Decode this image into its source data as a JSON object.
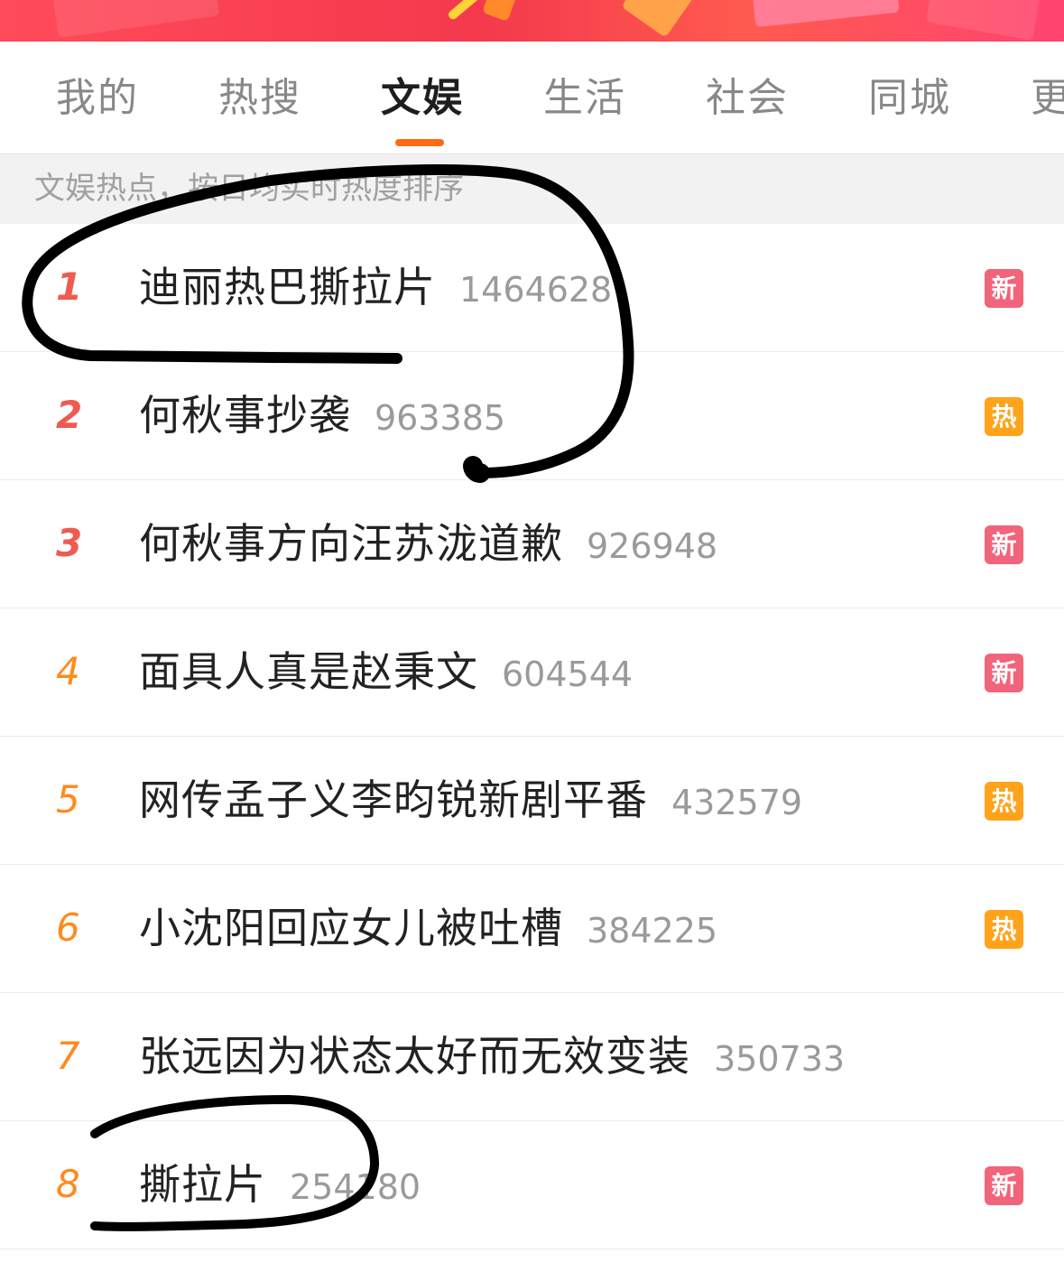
{
  "tabs": [
    {
      "label": "我的",
      "active": false
    },
    {
      "label": "热搜",
      "active": false
    },
    {
      "label": "文娱",
      "active": true
    },
    {
      "label": "生活",
      "active": false
    },
    {
      "label": "社会",
      "active": false
    },
    {
      "label": "同城",
      "active": false
    },
    {
      "label": "更",
      "active": false
    }
  ],
  "hint": "文娱热点，按日均实时热度排序",
  "list": [
    {
      "rank": "1",
      "title": "迪丽热巴撕拉片",
      "count": "1464628",
      "badge": "新",
      "badge_type": "new"
    },
    {
      "rank": "2",
      "title": "何秋事抄袭",
      "count": "963385",
      "badge": "热",
      "badge_type": "hot"
    },
    {
      "rank": "3",
      "title": "何秋事方向汪苏泷道歉",
      "count": "926948",
      "badge": "新",
      "badge_type": "new"
    },
    {
      "rank": "4",
      "title": "面具人真是赵秉文",
      "count": "604544",
      "badge": "新",
      "badge_type": "new"
    },
    {
      "rank": "5",
      "title": "网传孟子义李昀锐新剧平番",
      "count": "432579",
      "badge": "热",
      "badge_type": "hot"
    },
    {
      "rank": "6",
      "title": "小沈阳回应女儿被吐槽",
      "count": "384225",
      "badge": "热",
      "badge_type": "hot"
    },
    {
      "rank": "7",
      "title": "张远因为状态太好而无效变装",
      "count": "350733",
      "badge": "",
      "badge_type": "none"
    },
    {
      "rank": "8",
      "title": "撕拉片",
      "count": "254180",
      "badge": "新",
      "badge_type": "new"
    }
  ],
  "colors": {
    "accent": "#ff6a14",
    "rank_top": "#f05a50",
    "rank_other": "#ff8a1e",
    "badge_new": "#f2647b",
    "badge_hot": "#ffa31a"
  }
}
